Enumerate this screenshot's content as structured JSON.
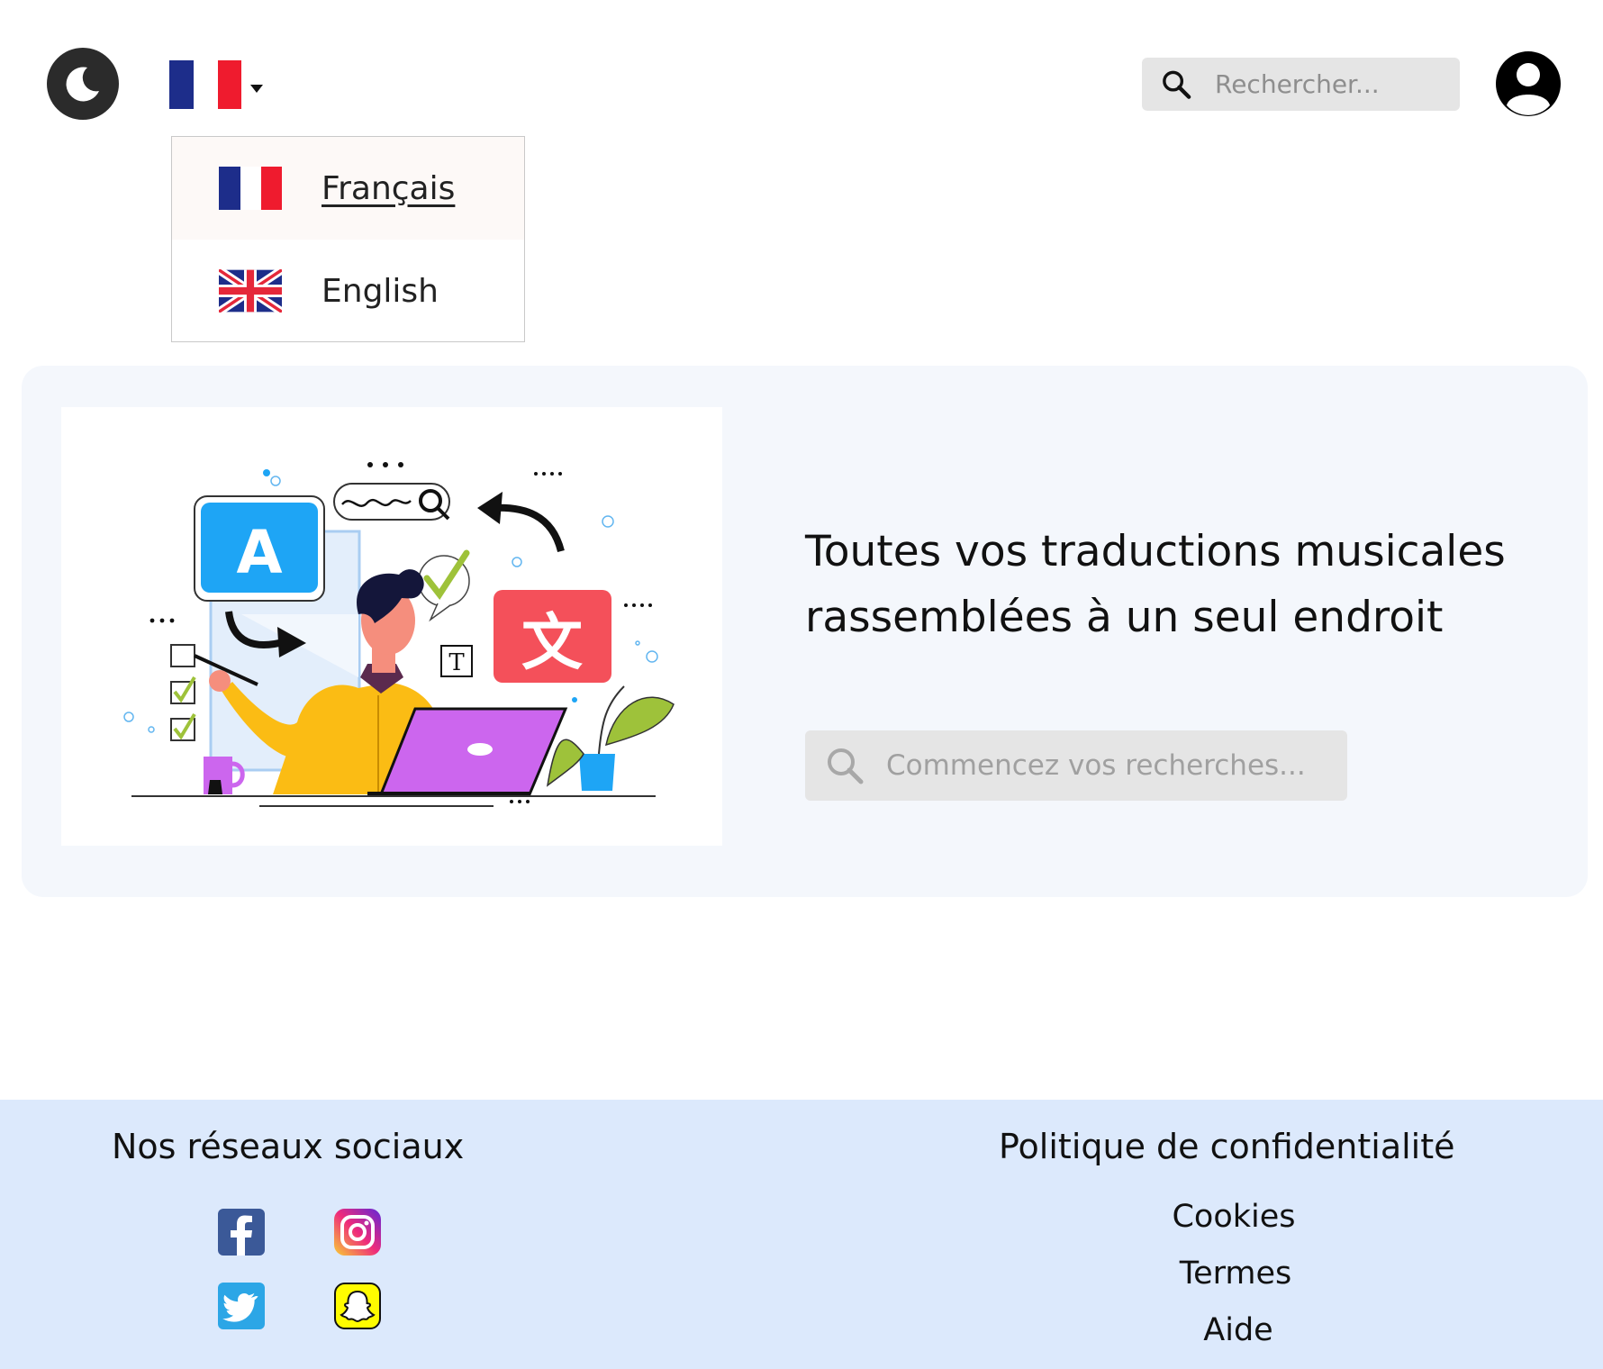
{
  "header": {
    "theme_toggle_icon": "moon-icon",
    "current_language_flag": "france-flag",
    "search": {
      "placeholder": "Rechercher..."
    },
    "profile_icon": "user-icon"
  },
  "language_menu": {
    "options": [
      {
        "label": "Français",
        "flag": "france-flag",
        "selected": true
      },
      {
        "label": "English",
        "flag": "uk-flag",
        "selected": false
      }
    ]
  },
  "hero": {
    "title_line1": "Toutes vos traductions musicales",
    "title_line2": "rassemblées à un seul endroit",
    "search": {
      "placeholder": "Commencez vos recherches..."
    },
    "illustration": {
      "letter_a": "A",
      "letter_wen": "文",
      "letter_t": "T"
    }
  },
  "footer": {
    "social_title": "Nos réseaux sociaux",
    "social_links": [
      "facebook-icon",
      "instagram-icon",
      "twitter-icon",
      "snapchat-icon"
    ],
    "privacy_title": "Politique de confidentialité",
    "links": [
      "Cookies",
      "Termes",
      "Aide"
    ]
  },
  "colors": {
    "hero_bg": "#f4f7fc",
    "footer_bg": "#dce9fc",
    "search_bg": "#e5e5e5",
    "accent_blue": "#1ea5f5",
    "accent_red": "#f4505a"
  }
}
